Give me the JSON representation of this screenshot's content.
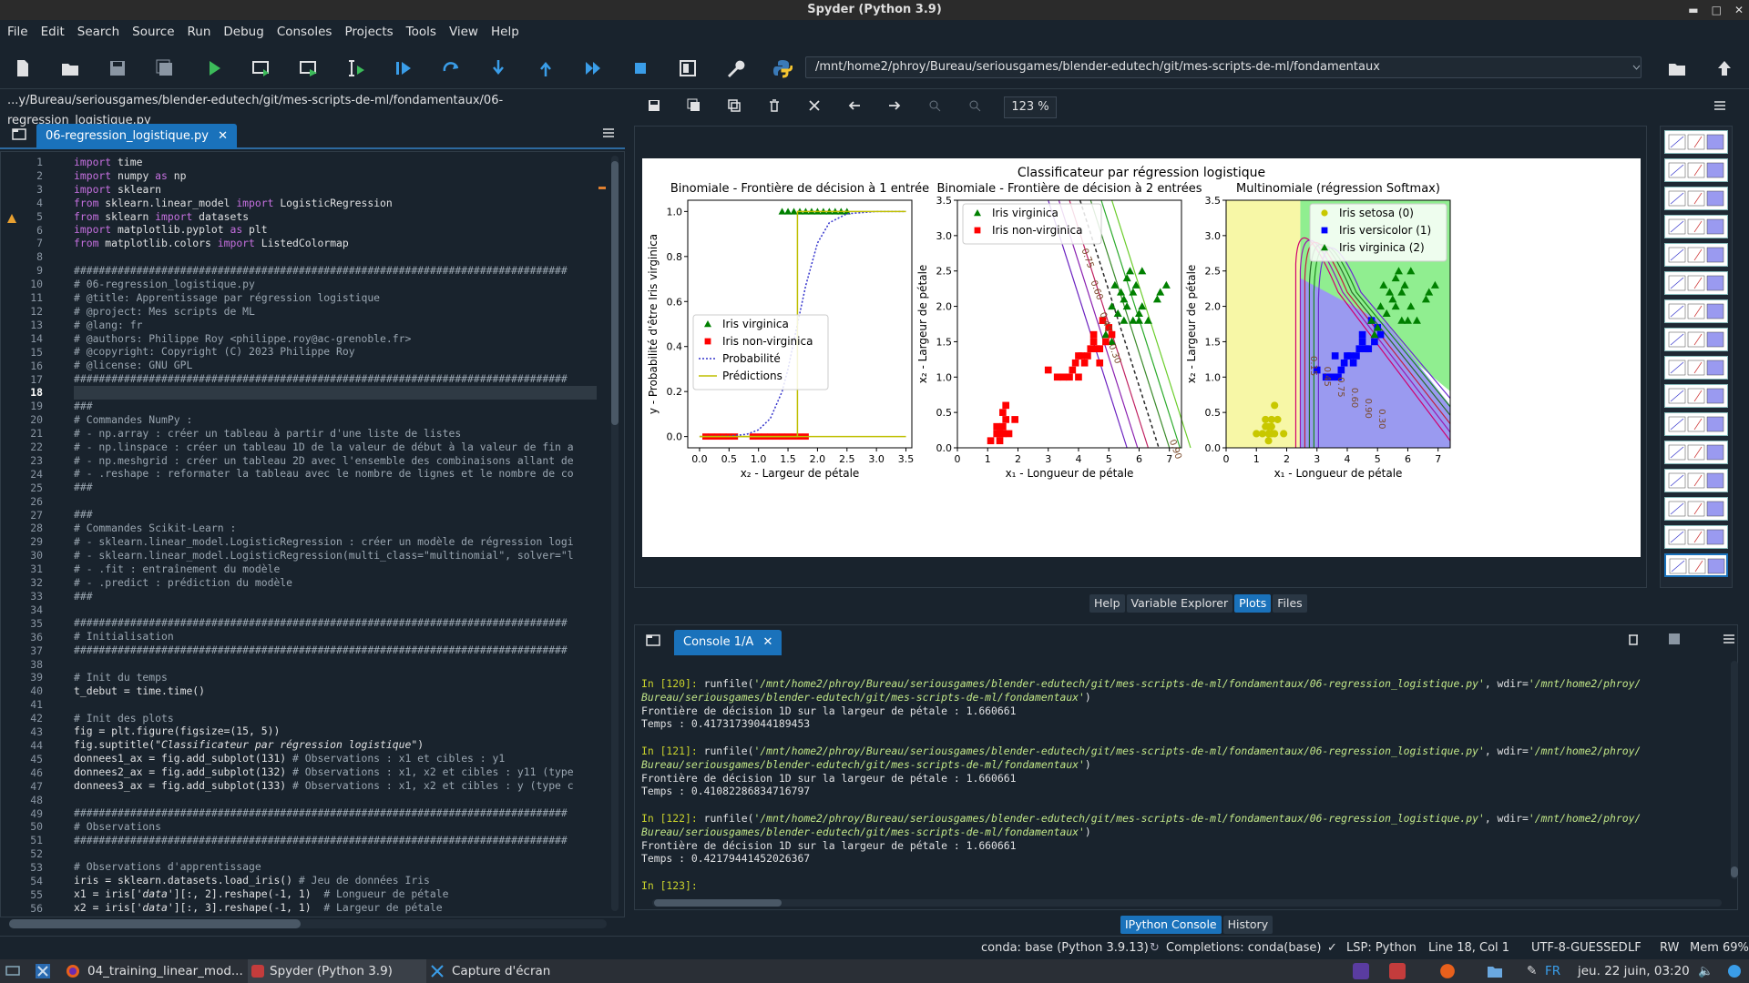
{
  "window": {
    "title": "Spyder (Python 3.9)"
  },
  "menu": [
    "File",
    "Edit",
    "Search",
    "Source",
    "Run",
    "Debug",
    "Consoles",
    "Projects",
    "Tools",
    "View",
    "Help"
  ],
  "toolbar": {
    "path": "/mnt/home2/phroy/Bureau/seriousgames/blender-edutech/git/mes-scripts-de-ml/fondamentaux"
  },
  "editor": {
    "file_path": "...y/Bureau/seriousgames/blender-edutech/git/mes-scripts-de-ml/fondamentaux/06-regression_logistique.py",
    "tab_label": "06-regression_logistique.py",
    "current_line": 18,
    "lines": [
      "import time",
      "import numpy as np",
      "import sklearn",
      "from sklearn.linear_model import LogisticRegression",
      "from sklearn import datasets",
      "import matplotlib.pyplot as plt",
      "from matplotlib.colors import ListedColormap",
      "",
      "###############################################################################",
      "# 06-regression_logistique.py",
      "# @title: Apprentissage par régression logistique",
      "# @project: Mes scripts de ML",
      "# @lang: fr",
      "# @authors: Philippe Roy <philippe.roy@ac-grenoble.fr>",
      "# @copyright: Copyright (C) 2023 Philippe Roy",
      "# @license: GNU GPL",
      "###############################################################################",
      "",
      "###",
      "# Commandes NumPy :",
      "# - np.array : créer un tableau à partir d'une liste de listes",
      "# - np.linspace : créer un tableau 1D de la valeur de début à la valeur de fin a",
      "# - np.meshgrid : créer un tableau 2D avec l'ensemble des combinaisons allant de",
      "# - .reshape : reformater la tableau avec le nombre de lignes et le nombre de co",
      "###",
      "",
      "###",
      "# Commandes Scikit-Learn :",
      "# - sklearn.linear_model.LogisticRegression : créer un modèle de régression logi",
      "# - sklearn.linear_model.LogisticRegression(multi_class=\"multinomial\", solver=\"l",
      "# - .fit : entraînement du modèle",
      "# - .predict : prédiction du modèle",
      "###",
      "",
      "###############################################################################",
      "# Initialisation",
      "###############################################################################",
      "",
      "# Init du temps",
      "t_debut = time.time()",
      "",
      "# Init des plots",
      "fig = plt.figure(figsize=(15, 5))",
      "fig.suptitle(\"Classificateur par régression logistique\")",
      "donnees1_ax = fig.add_subplot(131) # Observations : x1 et cibles : y1",
      "donnees2_ax = fig.add_subplot(132) # Observations : x1, x2 et cibles : y11 (type",
      "donnees3_ax = fig.add_subplot(133) # Observations : x1, x2 et cibles : y (type c",
      "",
      "###############################################################################",
      "# Observations",
      "###############################################################################",
      "",
      "# Observations d'apprentissage",
      "iris = sklearn.datasets.load_iris() # Jeu de données Iris",
      "x1 = iris['data'][:, 2].reshape(-1, 1)  # Longueur de pétale",
      "x2 = iris['data'][:, 3].reshape(-1, 1)  # Largeur de pétale"
    ]
  },
  "plots": {
    "zoom": "123 %",
    "tabs": [
      "Help",
      "Variable Explorer",
      "Plots",
      "Files"
    ],
    "active_tab": "Plots"
  },
  "figure": {
    "suptitle": "Classificateur par régression logistique",
    "colors": {
      "green": "#008000",
      "red": "#ff0000",
      "blue": "#0000ff",
      "yellow": "#c8c800",
      "prob": "#3333cc",
      "pred": "#bfbf00"
    }
  },
  "chart_data": [
    {
      "type": "scatter",
      "title": "Binomiale - Frontière de décision à 1 entrée",
      "xlabel": "x₂ - Largeur de pétale",
      "ylabel": "y - Probabilité d'être Iris virginica",
      "xlim": [
        -0.2,
        3.6
      ],
      "ylim": [
        -0.05,
        1.05
      ],
      "xticks": [
        "0.0",
        "0.5",
        "1.0",
        "1.5",
        "2.0",
        "2.5",
        "3.0",
        "3.5"
      ],
      "yticks": [
        "0.0",
        "0.2",
        "0.4",
        "0.6",
        "0.8",
        "1.0"
      ],
      "legend": [
        "Iris virginica",
        "Iris non-virginica",
        "Probabilité",
        "Prédictions"
      ],
      "legend_position": "center-left",
      "series": [
        {
          "name": "Iris virginica",
          "marker": "triangle",
          "color": "green",
          "x": [
            1.4,
            1.5,
            1.6,
            1.7,
            1.8,
            1.9,
            2.0,
            2.1,
            2.2,
            2.3,
            2.4,
            2.5
          ],
          "y": [
            1,
            1,
            1,
            1,
            1,
            1,
            1,
            1,
            1,
            1,
            1,
            1
          ]
        },
        {
          "name": "Iris non-virginica",
          "marker": "square",
          "color": "red",
          "x": [
            0.1,
            0.2,
            0.3,
            0.4,
            0.5,
            0.6,
            0.9,
            1.0,
            1.1,
            1.2,
            1.3,
            1.4,
            1.5,
            1.6,
            1.7,
            1.8
          ],
          "y": [
            0,
            0,
            0,
            0,
            0,
            0,
            0,
            0,
            0,
            0,
            0,
            0,
            0,
            0,
            0,
            0
          ]
        },
        {
          "name": "Probabilité",
          "style": "dotted",
          "x": [
            0.0,
            0.5,
            0.8,
            1.0,
            1.2,
            1.4,
            1.5,
            1.66,
            1.8,
            2.0,
            2.2,
            2.5,
            3.0,
            3.5
          ],
          "y": [
            0.0,
            0.002,
            0.01,
            0.03,
            0.08,
            0.2,
            0.3,
            0.5,
            0.67,
            0.86,
            0.95,
            0.99,
            1.0,
            1.0
          ]
        },
        {
          "name": "Prédictions",
          "style": "step",
          "x": [
            0.0,
            1.66,
            1.66,
            3.5
          ],
          "y": [
            0,
            0,
            1,
            1
          ]
        }
      ]
    },
    {
      "type": "scatter",
      "title": "Binomiale - Frontière de décision à 2 entrées",
      "xlabel": "x₁ - Longueur de pétale",
      "ylabel": "x₂ - Largeur de pétale",
      "xlim": [
        0,
        7.4
      ],
      "ylim": [
        0,
        3.5
      ],
      "xticks": [
        "0",
        "1",
        "2",
        "3",
        "4",
        "5",
        "6",
        "7"
      ],
      "yticks": [
        "0.0",
        "0.5",
        "1.0",
        "1.5",
        "2.0",
        "2.5",
        "3.0",
        "3.5"
      ],
      "legend": [
        "Iris virginica",
        "Iris non-virginica"
      ],
      "legend_position": "top-left",
      "contour_labels": [
        "0.75",
        "0.60",
        "0.45",
        "0.30",
        "0.90"
      ],
      "series": [
        {
          "name": "Iris virginica",
          "marker": "triangle",
          "color": "green",
          "x": [
            4.8,
            5.0,
            5.1,
            5.2,
            5.3,
            5.5,
            5.6,
            5.7,
            5.8,
            5.9,
            6.0,
            6.1,
            6.3,
            6.6,
            6.7,
            6.9,
            5.4,
            5.8,
            6.1,
            5.6,
            5.1,
            4.9,
            5.5,
            6.0
          ],
          "y": [
            1.8,
            1.7,
            2.0,
            2.3,
            1.9,
            2.1,
            2.4,
            2.5,
            1.8,
            2.3,
            1.8,
            2.5,
            1.8,
            2.1,
            2.2,
            2.3,
            2.2,
            2.2,
            2.0,
            2.0,
            1.5,
            1.6,
            1.8,
            1.9
          ]
        },
        {
          "name": "Iris non-virginica",
          "marker": "square",
          "color": "red",
          "x": [
            1.1,
            1.3,
            1.4,
            1.5,
            1.6,
            1.7,
            1.9,
            1.4,
            1.5,
            1.3,
            1.6,
            1.5,
            3.0,
            3.3,
            3.5,
            3.7,
            3.9,
            4.0,
            4.1,
            4.2,
            4.4,
            4.5,
            4.6,
            4.7,
            4.8,
            4.9,
            5.0,
            5.1,
            4.3,
            4.0,
            3.8,
            4.5,
            4.7
          ],
          "y": [
            0.1,
            0.2,
            0.2,
            0.3,
            0.4,
            0.2,
            0.4,
            0.1,
            0.5,
            0.3,
            0.6,
            0.2,
            1.1,
            1.0,
            1.0,
            1.0,
            1.2,
            1.3,
            1.3,
            1.2,
            1.4,
            1.5,
            1.4,
            1.4,
            1.8,
            1.5,
            1.7,
            1.6,
            1.3,
            1.0,
            1.1,
            1.6,
            1.2
          ]
        }
      ]
    },
    {
      "type": "scatter",
      "title": "Multinomiale (régression Softmax)",
      "xlabel": "x₁ - Longueur de pétale",
      "ylabel": "x₂ - Largeur de pétale",
      "xlim": [
        0,
        7.4
      ],
      "ylim": [
        0,
        3.5
      ],
      "xticks": [
        "0",
        "1",
        "2",
        "3",
        "4",
        "5",
        "6",
        "7"
      ],
      "yticks": [
        "0.0",
        "0.5",
        "1.0",
        "1.5",
        "2.0",
        "2.5",
        "3.0",
        "3.5"
      ],
      "legend": [
        "Iris setosa (0)",
        "Iris versicolor (1)",
        "Iris virginica (2)"
      ],
      "legend_position": "top-right",
      "contour_labels": [
        "0.15",
        "0.45",
        "0.75",
        "0.60",
        "0.90",
        "0.30"
      ],
      "series": [
        {
          "name": "Iris setosa (0)",
          "marker": "circle",
          "color": "yellow",
          "x": [
            1.0,
            1.2,
            1.3,
            1.4,
            1.5,
            1.6,
            1.7,
            1.9,
            1.4,
            1.5,
            1.3,
            1.6,
            1.5,
            1.4
          ],
          "y": [
            0.2,
            0.2,
            0.3,
            0.2,
            0.4,
            0.2,
            0.4,
            0.2,
            0.1,
            0.3,
            0.4,
            0.6,
            0.2,
            0.3
          ]
        },
        {
          "name": "Iris versicolor (1)",
          "marker": "square",
          "color": "blue",
          "x": [
            3.0,
            3.3,
            3.5,
            3.6,
            3.7,
            3.9,
            4.0,
            4.1,
            4.2,
            4.4,
            4.5,
            4.6,
            4.7,
            4.8,
            4.9,
            5.0,
            5.1,
            4.3,
            3.8,
            4.5
          ],
          "y": [
            1.1,
            1.0,
            1.0,
            1.3,
            1.0,
            1.2,
            1.3,
            1.3,
            1.2,
            1.4,
            1.5,
            1.4,
            1.4,
            1.8,
            1.5,
            1.7,
            1.6,
            1.3,
            1.1,
            1.6
          ]
        },
        {
          "name": "Iris virginica (2)",
          "marker": "triangle",
          "color": "green",
          "x": [
            4.8,
            5.0,
            5.1,
            5.2,
            5.3,
            5.5,
            5.6,
            5.7,
            5.8,
            5.9,
            6.0,
            6.1,
            6.3,
            6.6,
            6.7,
            6.9,
            5.4,
            5.8,
            6.1,
            5.6,
            4.9
          ],
          "y": [
            1.8,
            1.7,
            2.0,
            2.3,
            1.9,
            2.1,
            2.4,
            2.5,
            1.8,
            2.3,
            1.8,
            2.5,
            1.8,
            2.1,
            2.2,
            2.3,
            2.2,
            2.2,
            2.0,
            2.0,
            1.6
          ]
        }
      ]
    }
  ],
  "console": {
    "tab_label": "Console 1/A",
    "runs": [
      {
        "prompt": "In [120]:",
        "call": "runfile(",
        "path": "'/mnt/home2/phroy/Bureau/seriousgames/blender-edutech/git/mes-scripts-de-ml/fondamentaux/06-regression_logistique.py'",
        "wdir": ", wdir=",
        "wdir_path1": "'/mnt/home2/phroy/",
        "wdir_path2": "Bureau/seriousgames/blender-edutech/git/mes-scripts-de-ml/fondamentaux'",
        "close": ")",
        "out1": "Frontière de décision 1D sur la largeur de pétale : 1.660661",
        "out2": "Temps : 0.41731739044189453"
      },
      {
        "prompt": "In [121]:",
        "call": "runfile(",
        "path": "'/mnt/home2/phroy/Bureau/seriousgames/blender-edutech/git/mes-scripts-de-ml/fondamentaux/06-regression_logistique.py'",
        "wdir": ", wdir=",
        "wdir_path1": "'/mnt/home2/phroy/",
        "wdir_path2": "Bureau/seriousgames/blender-edutech/git/mes-scripts-de-ml/fondamentaux'",
        "close": ")",
        "out1": "Frontière de décision 1D sur la largeur de pétale : 1.660661",
        "out2": "Temps : 0.41082286834716797"
      },
      {
        "prompt": "In [122]:",
        "call": "runfile(",
        "path": "'/mnt/home2/phroy/Bureau/seriousgames/blender-edutech/git/mes-scripts-de-ml/fondamentaux/06-regression_logistique.py'",
        "wdir": ", wdir=",
        "wdir_path1": "'/mnt/home2/phroy/",
        "wdir_path2": "Bureau/seriousgames/blender-edutech/git/mes-scripts-de-ml/fondamentaux'",
        "close": ")",
        "out1": "Frontière de décision 1D sur la largeur de pétale : 1.660661",
        "out2": "Temps : 0.42179441452026367"
      }
    ],
    "last_prompt": "In [123]:",
    "tabs": [
      "IPython Console",
      "History"
    ]
  },
  "status": {
    "conda": "conda: base (Python 3.9.13)",
    "completions": "Completions: conda(base)",
    "lsp": "LSP: Python",
    "position": "Line 18, Col 1",
    "encoding": "UTF-8-GUESSED",
    "eol": "LF",
    "rw": "RW",
    "mem": "Mem 69%"
  },
  "taskbar": {
    "items": [
      "04_training_linear_mod...",
      "Spyder (Python 3.9)",
      "Capture d'écran"
    ],
    "lang": "FR",
    "clock": "jeu. 22 juin, 03:20"
  }
}
